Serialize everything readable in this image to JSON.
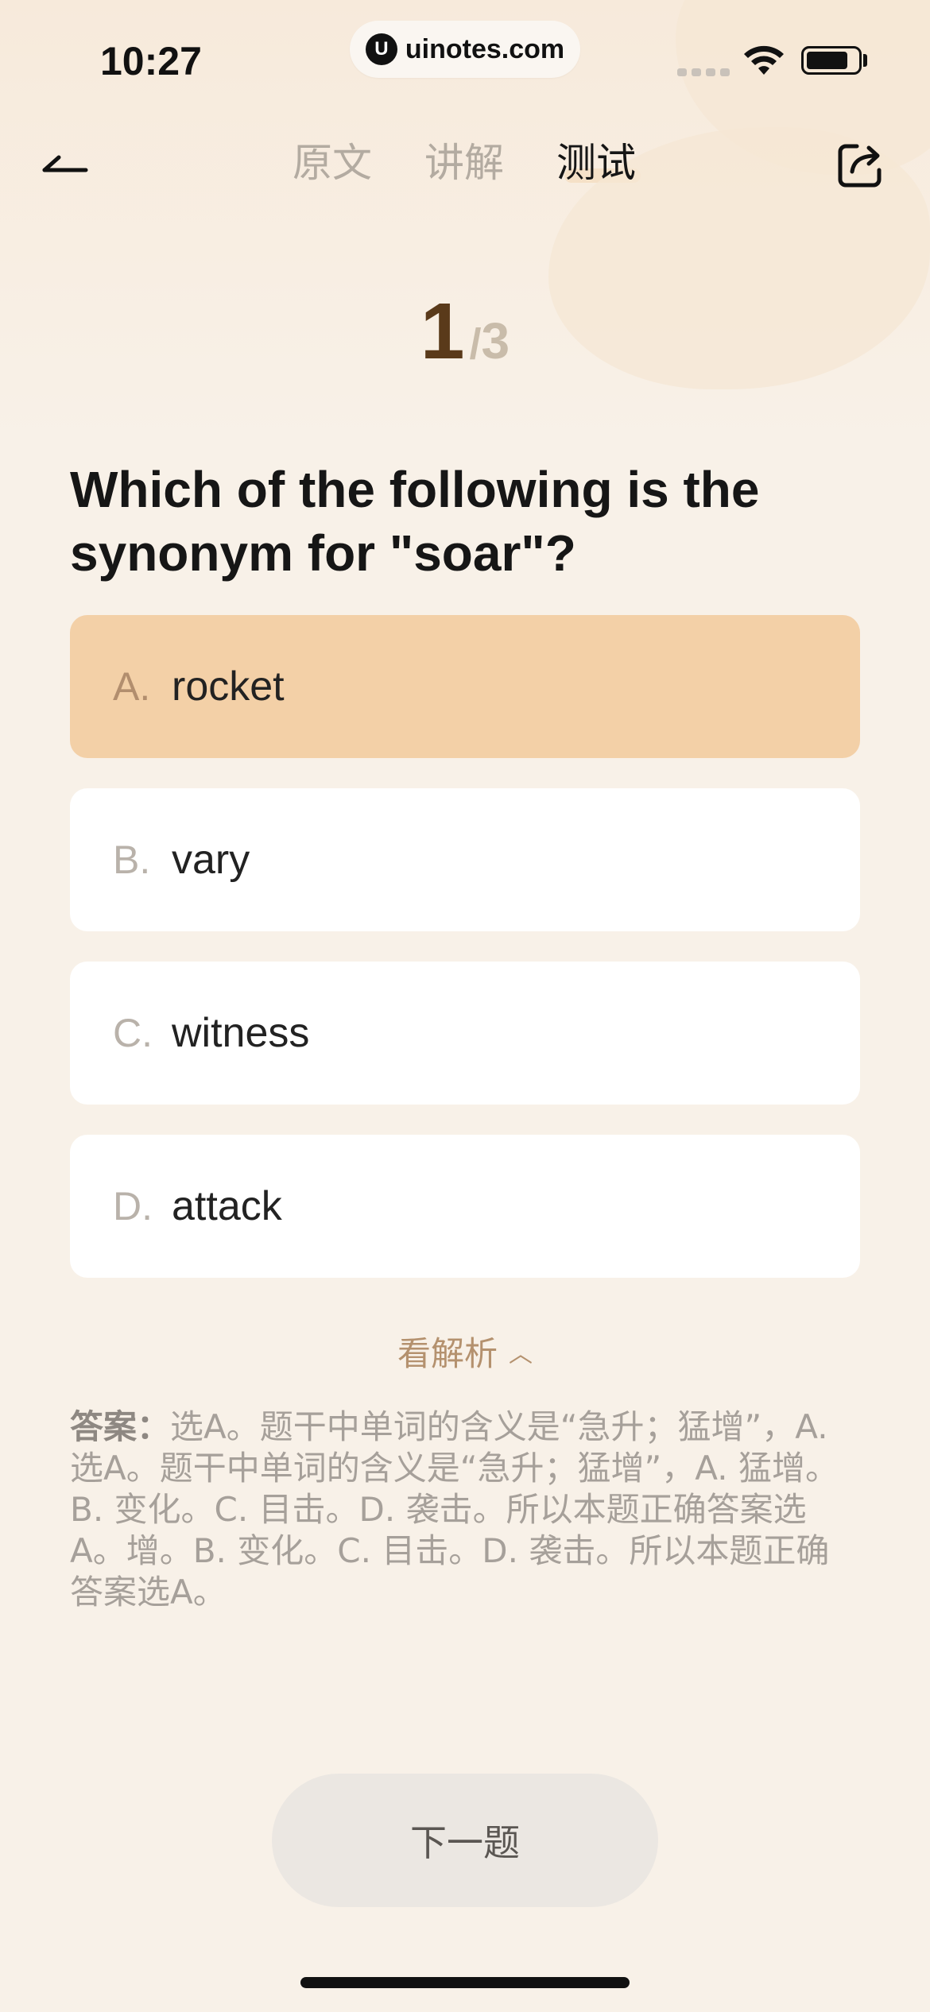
{
  "status_bar": {
    "time": "10:27",
    "url": "uinotes.com",
    "url_icon_glyph": "U"
  },
  "nav": {
    "back_icon": "back-arrow-icon",
    "tabs": [
      {
        "label": "原文",
        "active": false
      },
      {
        "label": "讲解",
        "active": false
      },
      {
        "label": "测试",
        "active": true
      }
    ],
    "share_icon": "share-icon"
  },
  "progress": {
    "current": "1",
    "separator": "/",
    "total": "3"
  },
  "question": {
    "text": "Which of the following is the synonym for \"soar\"?"
  },
  "options": [
    {
      "letter": "A.",
      "text": "rocket",
      "selected": true
    },
    {
      "letter": "B.",
      "text": "vary",
      "selected": false
    },
    {
      "letter": "C.",
      "text": "witness",
      "selected": false
    },
    {
      "letter": "D.",
      "text": "attack",
      "selected": false
    }
  ],
  "analysis": {
    "toggle_label": "看解析",
    "toggle_icon": "chevron-up-icon",
    "label": "答案：",
    "text": "选A。题干中单词的含义是“急升；猛增”，A. 选A。题干中单词的含义是“急升；猛增”，A. 猛增。B. 变化。C. 目击。D. 袭击。所以本题正确答案选A。增。B. 变化。C. 目击。D. 袭击。所以本题正确答案选A。"
  },
  "next_button": {
    "label": "下一题"
  },
  "colors": {
    "background": "#f8f1e8",
    "selected_option": "#f3d0a7",
    "accent_brown": "#5a3a1a",
    "analysis_link": "#b4916e"
  }
}
